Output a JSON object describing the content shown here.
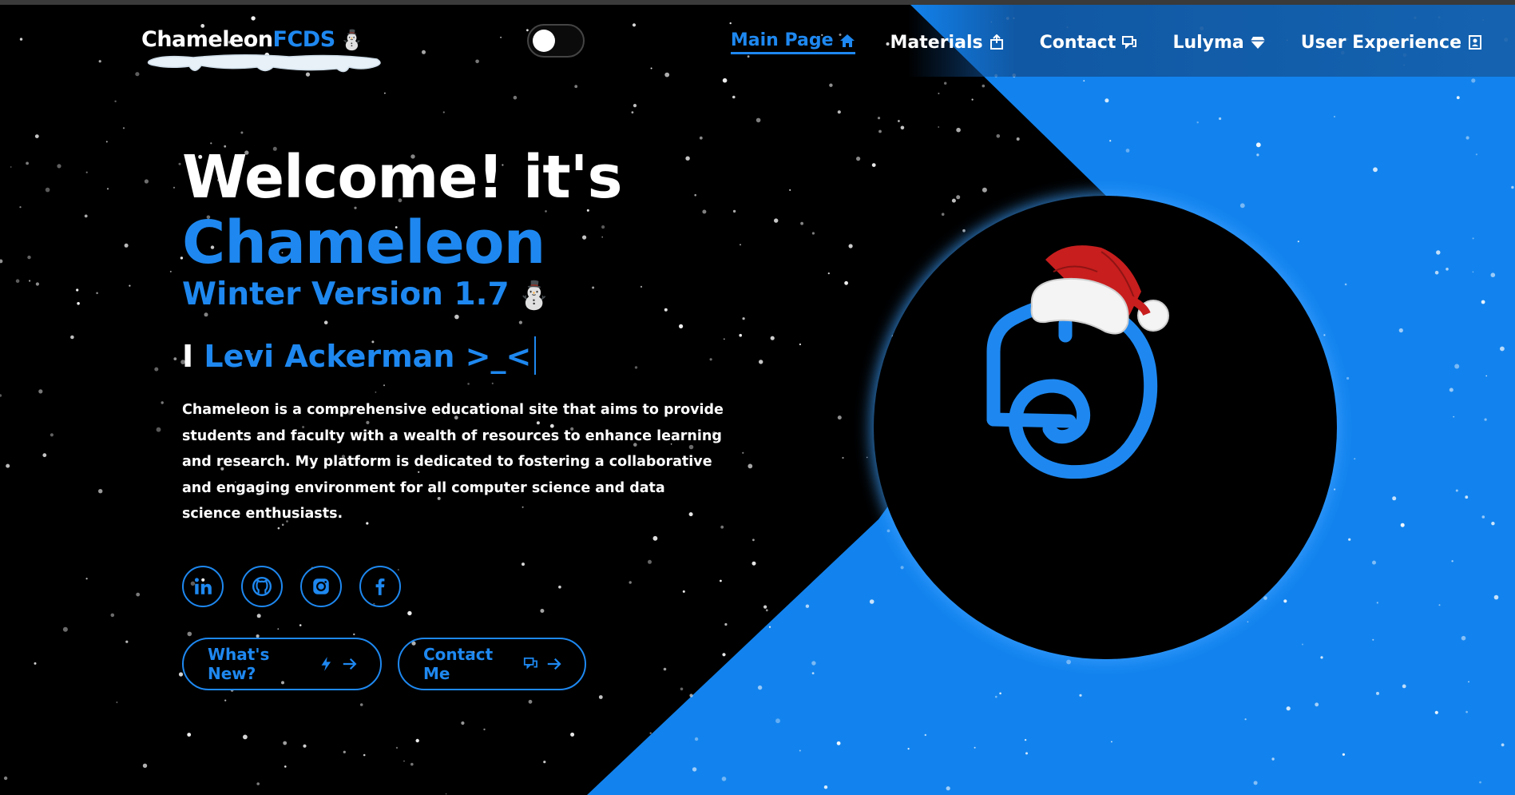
{
  "brand": {
    "name_white": "Chameleon",
    "name_blue": "FCDS",
    "snowman": "⛄"
  },
  "nav": {
    "items": [
      {
        "label": "Main Page",
        "icon": "home-icon",
        "active": true
      },
      {
        "label": "Materials",
        "icon": "box-icon",
        "active": false
      },
      {
        "label": "Contact",
        "icon": "chat-icon",
        "active": false
      },
      {
        "label": "Lulyma",
        "icon": "gem-icon",
        "active": false
      },
      {
        "label": "User Experience",
        "icon": "user-card-icon",
        "active": false
      }
    ]
  },
  "hero": {
    "line1": "Welcome! it's",
    "line2": "Chameleon",
    "version": "Winter Version 1.7",
    "version_emoji": "⛄",
    "typed_prefix": "I",
    "typed_name": "Levi Ackerman >_<",
    "description": "Chameleon is a comprehensive educational site that aims to provide students and faculty with a wealth of resources to enhance learning and research. My platform is dedicated to fostering a collaborative and engaging environment for all computer science and data science enthusiasts."
  },
  "socials": [
    "linkedin-icon",
    "github-icon",
    "instagram-icon",
    "facebook-icon"
  ],
  "buttons": {
    "whats_new": "What's New?",
    "contact_me": "Contact Me"
  },
  "colors": {
    "accent": "#1e88f0",
    "background": "#000000",
    "panel_blue": "#1283ee",
    "hat_red": "#cc1f1f"
  }
}
